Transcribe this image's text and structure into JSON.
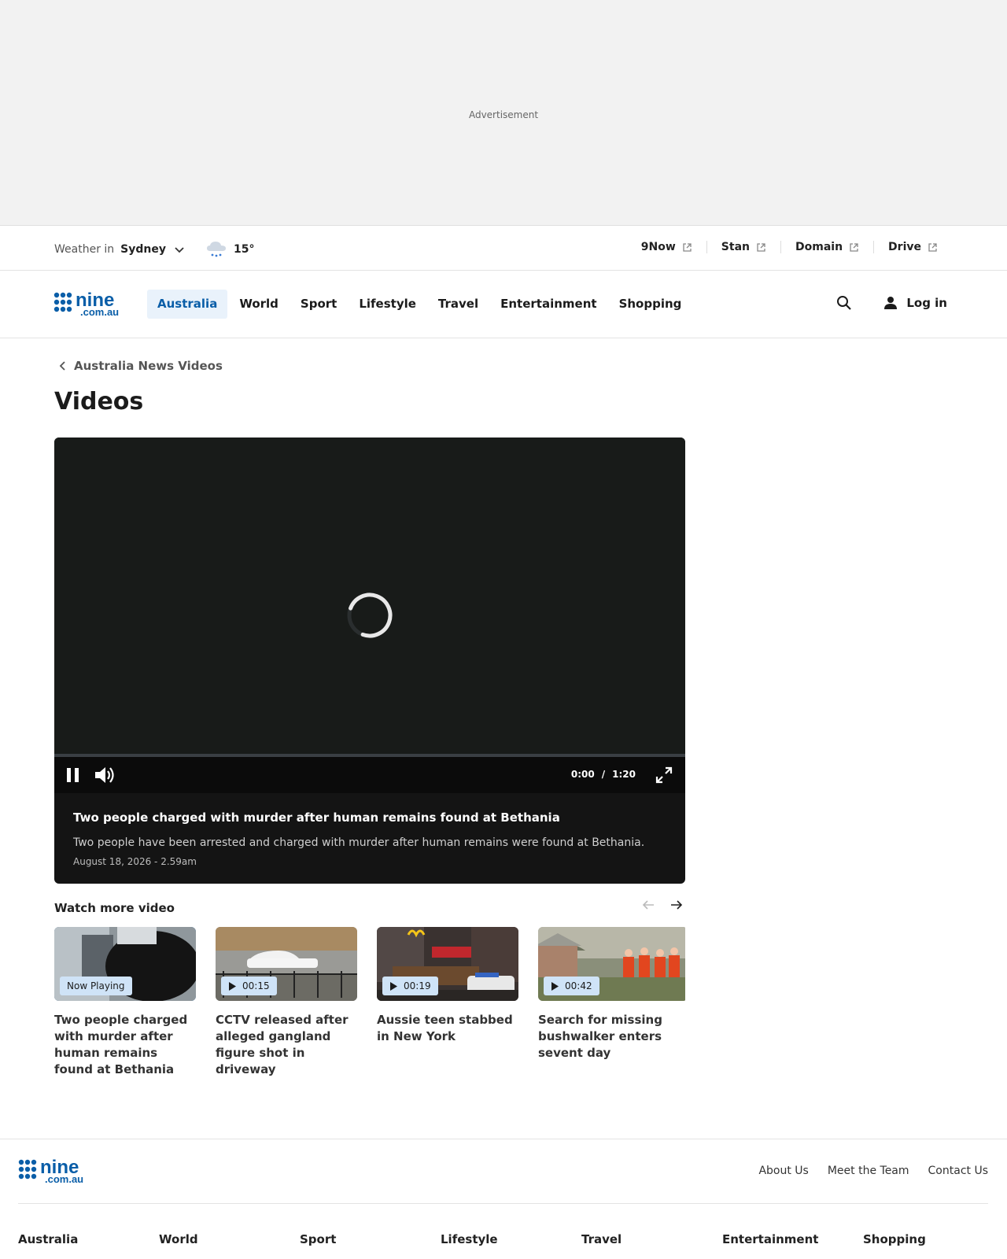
{
  "ad": {
    "label": "Advertisement"
  },
  "weather": {
    "label": "Weather in",
    "city": "Sydney",
    "temp": "15°"
  },
  "external_links": [
    "9Now",
    "Stan",
    "Domain",
    "Drive"
  ],
  "nav": {
    "items": [
      "Australia",
      "World",
      "Sport",
      "Lifestyle",
      "Travel",
      "Entertainment",
      "Shopping"
    ],
    "active": "Australia",
    "login": "Log in"
  },
  "breadcrumb": "Australia News Videos",
  "page_title": "Videos",
  "player": {
    "current_time": "0:00",
    "separator": "/",
    "duration": "1:20",
    "progress": 0,
    "title": "Two people charged with murder after human remains found at Bethania",
    "description": "Two people have been arrested and charged with murder after human remains were found at Bethania.",
    "date": "August 18, 2026 - 2.59am"
  },
  "watch_more": {
    "heading": "Watch more video",
    "cards": [
      {
        "badge": "Now Playing",
        "title": "Two people charged with murder after human remains found at Bethania"
      },
      {
        "badge": "00:15",
        "title": "CCTV released after alleged gangland figure shot in driveway"
      },
      {
        "badge": "00:19",
        "title": "Aussie teen stabbed in New York"
      },
      {
        "badge": "00:42",
        "title": "Search for missing bushwalker enters sevent day"
      }
    ]
  },
  "footer": {
    "links": [
      "About Us",
      "Meet the Team",
      "Contact Us"
    ],
    "categories": [
      "Australia",
      "World",
      "Sport",
      "Lifestyle",
      "Travel",
      "Entertainment",
      "Shopping"
    ]
  },
  "colors": {
    "brand_blue": "#0a5ea8",
    "accent_blue": "#1f78c8",
    "player_bg": "#181b19"
  }
}
